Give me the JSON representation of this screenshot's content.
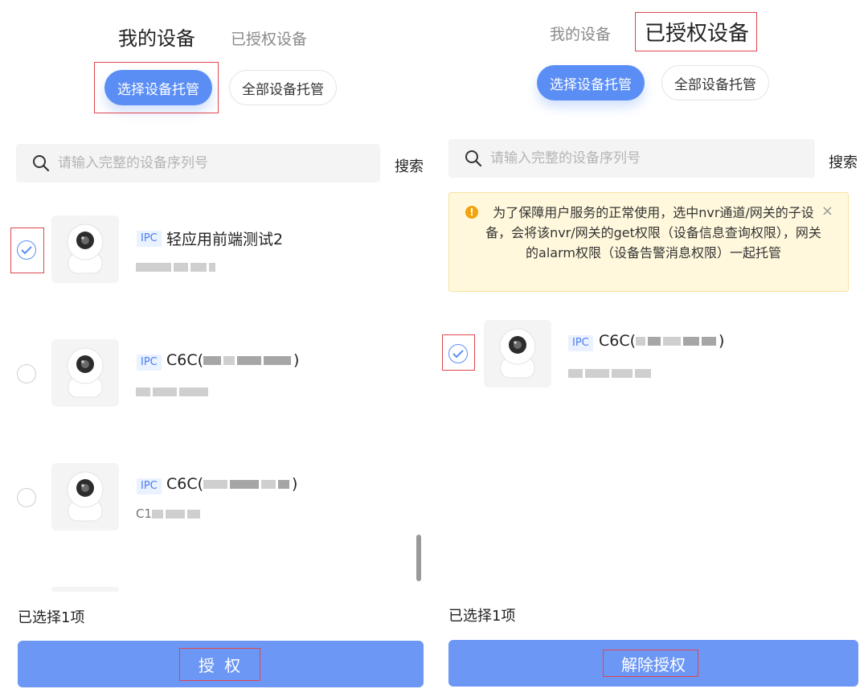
{
  "left_screen": {
    "tabs": [
      "我的设备",
      "已授权设备"
    ],
    "mode_buttons": [
      "选择设备托管",
      "全部设备托管"
    ],
    "search": {
      "placeholder": "请输入完整的设备序列号",
      "button": "搜索"
    },
    "devices": [
      {
        "tag": "IPC",
        "name": "轻应用前端测试2",
        "checked": true
      },
      {
        "tag": "IPC",
        "name": "C6C(",
        "name_suffix": ")",
        "checked": false
      },
      {
        "tag": "IPC",
        "name": "C6C(",
        "name_suffix": ")",
        "sub_prefix": "C1",
        "checked": false
      }
    ],
    "selected_count": "已选择1项",
    "action_button": "授 权"
  },
  "right_screen": {
    "tabs": [
      "我的设备",
      "已授权设备"
    ],
    "mode_buttons": [
      "选择设备托管",
      "全部设备托管"
    ],
    "search": {
      "placeholder": "请输入完整的设备序列号",
      "button": "搜索"
    },
    "notice": {
      "icon": "warning-icon",
      "text": "为了保障用户服务的正常使用，选中nvr通道/网关的子设备，会将该nvr/网关的get权限（设备信息查询权限），网关的alarm权限（设备告警消息权限）一起托管",
      "close": "×"
    },
    "devices": [
      {
        "tag": "IPC",
        "name": "C6C(",
        "name_suffix": ")",
        "checked": true
      }
    ],
    "selected_count": "已选择1项",
    "action_button": "解除授权"
  },
  "colors": {
    "primary": "#5b8ef5",
    "button": "#6c97f5",
    "highlight_box": "#e0454f",
    "notice_bg": "#fff8dc",
    "warning": "#f2a40e"
  }
}
